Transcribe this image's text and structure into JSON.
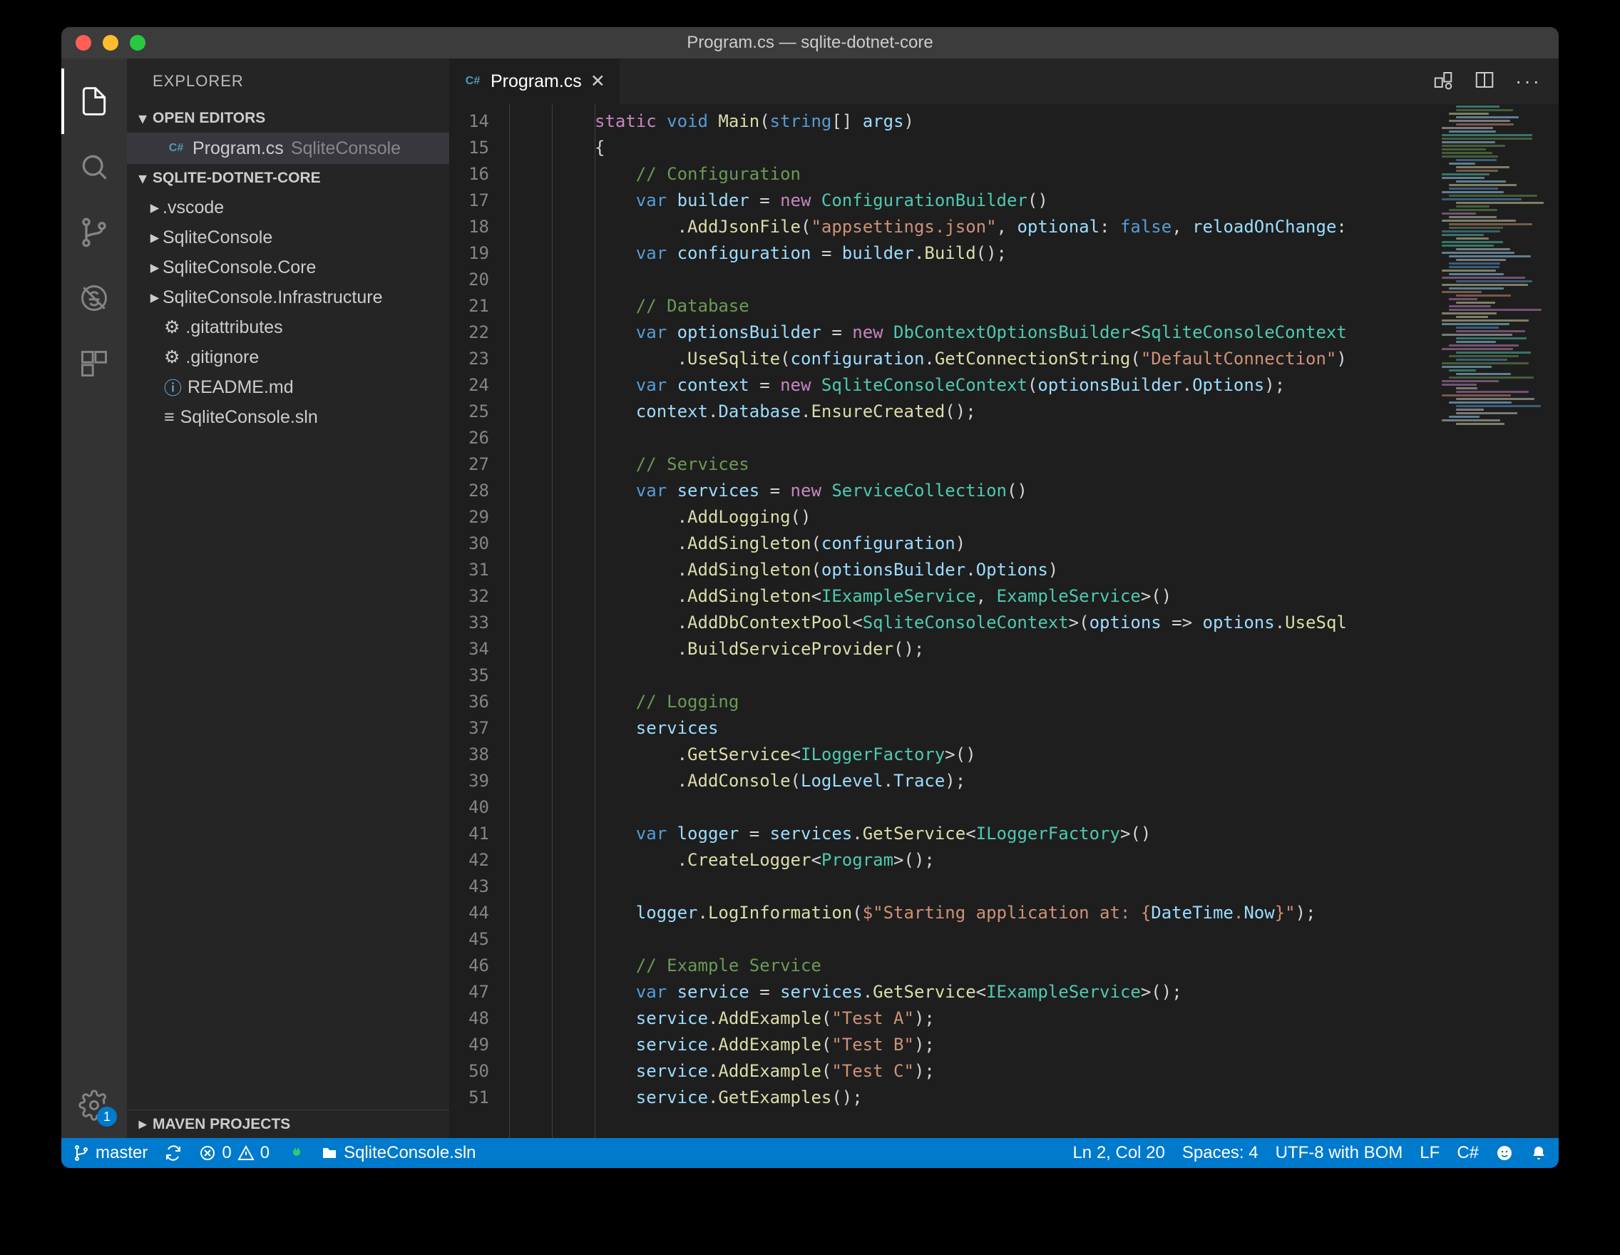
{
  "window": {
    "title": "Program.cs — sqlite-dotnet-core"
  },
  "activitybar": {
    "settings_badge": "1"
  },
  "sidebar": {
    "title": "EXPLORER",
    "open_editors_label": "OPEN EDITORS",
    "project_label": "SQLITE-DOTNET-CORE",
    "maven_label": "MAVEN PROJECTS",
    "open_editor": {
      "name": "Program.cs",
      "path": "SqliteConsole"
    },
    "tree": [
      {
        "label": ".vscode",
        "kind": "folder"
      },
      {
        "label": "SqliteConsole",
        "kind": "folder"
      },
      {
        "label": "SqliteConsole.Core",
        "kind": "folder"
      },
      {
        "label": "SqliteConsole.Infrastructure",
        "kind": "folder"
      },
      {
        "label": ".gitattributes",
        "kind": "gear"
      },
      {
        "label": ".gitignore",
        "kind": "gear"
      },
      {
        "label": "README.md",
        "kind": "info"
      },
      {
        "label": "SqliteConsole.sln",
        "kind": "lines"
      }
    ]
  },
  "tab": {
    "filename": "Program.cs"
  },
  "gutter_start": 14,
  "gutter_end": 51,
  "code": [
    {
      "indent": 2,
      "tokens": [
        [
          "static ",
          "k-purple"
        ],
        [
          "void ",
          "k-blue"
        ],
        [
          "Main",
          "k-yellow"
        ],
        [
          "(",
          "k-white"
        ],
        [
          "string",
          "k-blue"
        ],
        [
          "[] ",
          "k-white"
        ],
        [
          "args",
          "k-lblue"
        ],
        [
          ")",
          "k-white"
        ]
      ]
    },
    {
      "indent": 2,
      "tokens": [
        [
          "{",
          "k-white"
        ]
      ]
    },
    {
      "indent": 3,
      "tokens": [
        [
          "// Configuration",
          "k-comment"
        ]
      ]
    },
    {
      "indent": 3,
      "tokens": [
        [
          "var ",
          "k-blue"
        ],
        [
          "builder",
          "k-lblue"
        ],
        [
          " = ",
          "k-white"
        ],
        [
          "new ",
          "k-purple"
        ],
        [
          "ConfigurationBuilder",
          "k-type"
        ],
        [
          "()",
          "k-white"
        ]
      ]
    },
    {
      "indent": 4,
      "tokens": [
        [
          ".",
          "k-white"
        ],
        [
          "AddJsonFile",
          "k-yellow"
        ],
        [
          "(",
          "k-white"
        ],
        [
          "\"appsettings.json\"",
          "k-str"
        ],
        [
          ", ",
          "k-white"
        ],
        [
          "optional",
          "k-lblue"
        ],
        [
          ": ",
          "k-white"
        ],
        [
          "false",
          "k-blue"
        ],
        [
          ", ",
          "k-white"
        ],
        [
          "reloadOnChange",
          "k-lblue"
        ],
        [
          ":",
          "k-white"
        ]
      ]
    },
    {
      "indent": 3,
      "tokens": [
        [
          "var ",
          "k-blue"
        ],
        [
          "configuration",
          "k-lblue"
        ],
        [
          " = ",
          "k-white"
        ],
        [
          "builder",
          "k-lblue"
        ],
        [
          ".",
          "k-white"
        ],
        [
          "Build",
          "k-yellow"
        ],
        [
          "();",
          "k-white"
        ]
      ]
    },
    {
      "indent": 3,
      "tokens": [
        [
          "",
          "k-white"
        ]
      ]
    },
    {
      "indent": 3,
      "tokens": [
        [
          "// Database",
          "k-comment"
        ]
      ]
    },
    {
      "indent": 3,
      "tokens": [
        [
          "var ",
          "k-blue"
        ],
        [
          "optionsBuilder",
          "k-lblue"
        ],
        [
          " = ",
          "k-white"
        ],
        [
          "new ",
          "k-purple"
        ],
        [
          "DbContextOptionsBuilder",
          "k-type"
        ],
        [
          "<",
          "k-white"
        ],
        [
          "SqliteConsoleContext",
          "k-type"
        ]
      ]
    },
    {
      "indent": 4,
      "tokens": [
        [
          ".",
          "k-white"
        ],
        [
          "UseSqlite",
          "k-yellow"
        ],
        [
          "(",
          "k-white"
        ],
        [
          "configuration",
          "k-lblue"
        ],
        [
          ".",
          "k-white"
        ],
        [
          "GetConnectionString",
          "k-yellow"
        ],
        [
          "(",
          "k-white"
        ],
        [
          "\"DefaultConnection\"",
          "k-str"
        ],
        [
          ")",
          "k-white"
        ]
      ]
    },
    {
      "indent": 3,
      "tokens": [
        [
          "var ",
          "k-blue"
        ],
        [
          "context",
          "k-lblue"
        ],
        [
          " = ",
          "k-white"
        ],
        [
          "new ",
          "k-purple"
        ],
        [
          "SqliteConsoleContext",
          "k-type"
        ],
        [
          "(",
          "k-white"
        ],
        [
          "optionsBuilder",
          "k-lblue"
        ],
        [
          ".",
          "k-white"
        ],
        [
          "Options",
          "k-lblue"
        ],
        [
          ");",
          "k-white"
        ]
      ]
    },
    {
      "indent": 3,
      "tokens": [
        [
          "context",
          "k-lblue"
        ],
        [
          ".",
          "k-white"
        ],
        [
          "Database",
          "k-lblue"
        ],
        [
          ".",
          "k-white"
        ],
        [
          "EnsureCreated",
          "k-yellow"
        ],
        [
          "();",
          "k-white"
        ]
      ]
    },
    {
      "indent": 3,
      "tokens": [
        [
          "",
          "k-white"
        ]
      ]
    },
    {
      "indent": 3,
      "tokens": [
        [
          "// Services",
          "k-comment"
        ]
      ]
    },
    {
      "indent": 3,
      "tokens": [
        [
          "var ",
          "k-blue"
        ],
        [
          "services",
          "k-lblue"
        ],
        [
          " = ",
          "k-white"
        ],
        [
          "new ",
          "k-purple"
        ],
        [
          "ServiceCollection",
          "k-type"
        ],
        [
          "()",
          "k-white"
        ]
      ]
    },
    {
      "indent": 4,
      "tokens": [
        [
          ".",
          "k-white"
        ],
        [
          "AddLogging",
          "k-yellow"
        ],
        [
          "()",
          "k-white"
        ]
      ]
    },
    {
      "indent": 4,
      "tokens": [
        [
          ".",
          "k-white"
        ],
        [
          "AddSingleton",
          "k-yellow"
        ],
        [
          "(",
          "k-white"
        ],
        [
          "configuration",
          "k-lblue"
        ],
        [
          ")",
          "k-white"
        ]
      ]
    },
    {
      "indent": 4,
      "tokens": [
        [
          ".",
          "k-white"
        ],
        [
          "AddSingleton",
          "k-yellow"
        ],
        [
          "(",
          "k-white"
        ],
        [
          "optionsBuilder",
          "k-lblue"
        ],
        [
          ".",
          "k-white"
        ],
        [
          "Options",
          "k-lblue"
        ],
        [
          ")",
          "k-white"
        ]
      ]
    },
    {
      "indent": 4,
      "tokens": [
        [
          ".",
          "k-white"
        ],
        [
          "AddSingleton",
          "k-yellow"
        ],
        [
          "<",
          "k-white"
        ],
        [
          "IExampleService",
          "k-type"
        ],
        [
          ", ",
          "k-white"
        ],
        [
          "ExampleService",
          "k-type"
        ],
        [
          ">()",
          "k-white"
        ]
      ]
    },
    {
      "indent": 4,
      "tokens": [
        [
          ".",
          "k-white"
        ],
        [
          "AddDbContextPool",
          "k-yellow"
        ],
        [
          "<",
          "k-white"
        ],
        [
          "SqliteConsoleContext",
          "k-type"
        ],
        [
          ">(",
          "k-white"
        ],
        [
          "options",
          "k-lblue"
        ],
        [
          " => ",
          "k-white"
        ],
        [
          "options",
          "k-lblue"
        ],
        [
          ".",
          "k-white"
        ],
        [
          "UseSql",
          "k-yellow"
        ]
      ]
    },
    {
      "indent": 4,
      "tokens": [
        [
          ".",
          "k-white"
        ],
        [
          "BuildServiceProvider",
          "k-yellow"
        ],
        [
          "();",
          "k-white"
        ]
      ]
    },
    {
      "indent": 3,
      "tokens": [
        [
          "",
          "k-white"
        ]
      ]
    },
    {
      "indent": 3,
      "tokens": [
        [
          "// Logging",
          "k-comment"
        ]
      ]
    },
    {
      "indent": 3,
      "tokens": [
        [
          "services",
          "k-lblue"
        ]
      ]
    },
    {
      "indent": 4,
      "tokens": [
        [
          ".",
          "k-white"
        ],
        [
          "GetService",
          "k-yellow"
        ],
        [
          "<",
          "k-white"
        ],
        [
          "ILoggerFactory",
          "k-type"
        ],
        [
          ">()",
          "k-white"
        ]
      ]
    },
    {
      "indent": 4,
      "tokens": [
        [
          ".",
          "k-white"
        ],
        [
          "AddConsole",
          "k-yellow"
        ],
        [
          "(",
          "k-white"
        ],
        [
          "LogLevel",
          "k-lblue"
        ],
        [
          ".",
          "k-white"
        ],
        [
          "Trace",
          "k-lblue"
        ],
        [
          ");",
          "k-white"
        ]
      ]
    },
    {
      "indent": 3,
      "tokens": [
        [
          "",
          "k-white"
        ]
      ]
    },
    {
      "indent": 3,
      "tokens": [
        [
          "var ",
          "k-blue"
        ],
        [
          "logger",
          "k-lblue"
        ],
        [
          " = ",
          "k-white"
        ],
        [
          "services",
          "k-lblue"
        ],
        [
          ".",
          "k-white"
        ],
        [
          "GetService",
          "k-yellow"
        ],
        [
          "<",
          "k-white"
        ],
        [
          "ILoggerFactory",
          "k-type"
        ],
        [
          ">()",
          "k-white"
        ]
      ]
    },
    {
      "indent": 4,
      "tokens": [
        [
          ".",
          "k-white"
        ],
        [
          "CreateLogger",
          "k-yellow"
        ],
        [
          "<",
          "k-white"
        ],
        [
          "Program",
          "k-type"
        ],
        [
          ">();",
          "k-white"
        ]
      ]
    },
    {
      "indent": 3,
      "tokens": [
        [
          "",
          "k-white"
        ]
      ]
    },
    {
      "indent": 3,
      "tokens": [
        [
          "logger",
          "k-lblue"
        ],
        [
          ".",
          "k-white"
        ],
        [
          "LogInformation",
          "k-yellow"
        ],
        [
          "(",
          "k-white"
        ],
        [
          "$\"Starting application at: {",
          "k-str"
        ],
        [
          "DateTime",
          "k-lblue"
        ],
        [
          ".",
          "k-str"
        ],
        [
          "Now",
          "k-lblue"
        ],
        [
          "}\"",
          "k-str"
        ],
        [
          ");",
          "k-white"
        ]
      ]
    },
    {
      "indent": 3,
      "tokens": [
        [
          "",
          "k-white"
        ]
      ]
    },
    {
      "indent": 3,
      "tokens": [
        [
          "// Example Service",
          "k-comment"
        ]
      ]
    },
    {
      "indent": 3,
      "tokens": [
        [
          "var ",
          "k-blue"
        ],
        [
          "service",
          "k-lblue"
        ],
        [
          " = ",
          "k-white"
        ],
        [
          "services",
          "k-lblue"
        ],
        [
          ".",
          "k-white"
        ],
        [
          "GetService",
          "k-yellow"
        ],
        [
          "<",
          "k-white"
        ],
        [
          "IExampleService",
          "k-type"
        ],
        [
          ">();",
          "k-white"
        ]
      ]
    },
    {
      "indent": 3,
      "tokens": [
        [
          "service",
          "k-lblue"
        ],
        [
          ".",
          "k-white"
        ],
        [
          "AddExample",
          "k-yellow"
        ],
        [
          "(",
          "k-white"
        ],
        [
          "\"Test A\"",
          "k-str"
        ],
        [
          ");",
          "k-white"
        ]
      ]
    },
    {
      "indent": 3,
      "tokens": [
        [
          "service",
          "k-lblue"
        ],
        [
          ".",
          "k-white"
        ],
        [
          "AddExample",
          "k-yellow"
        ],
        [
          "(",
          "k-white"
        ],
        [
          "\"Test B\"",
          "k-str"
        ],
        [
          ");",
          "k-white"
        ]
      ]
    },
    {
      "indent": 3,
      "tokens": [
        [
          "service",
          "k-lblue"
        ],
        [
          ".",
          "k-white"
        ],
        [
          "AddExample",
          "k-yellow"
        ],
        [
          "(",
          "k-white"
        ],
        [
          "\"Test C\"",
          "k-str"
        ],
        [
          ");",
          "k-white"
        ]
      ]
    },
    {
      "indent": 3,
      "tokens": [
        [
          "service",
          "k-lblue"
        ],
        [
          ".",
          "k-white"
        ],
        [
          "GetExamples",
          "k-yellow"
        ],
        [
          "();",
          "k-white"
        ]
      ]
    }
  ],
  "status": {
    "branch": "master",
    "errors": "0",
    "warnings": "0",
    "project": "SqliteConsole.sln",
    "cursor": "Ln 2, Col 20",
    "spaces": "Spaces: 4",
    "encoding": "UTF-8 with BOM",
    "eol": "LF",
    "lang": "C#"
  }
}
